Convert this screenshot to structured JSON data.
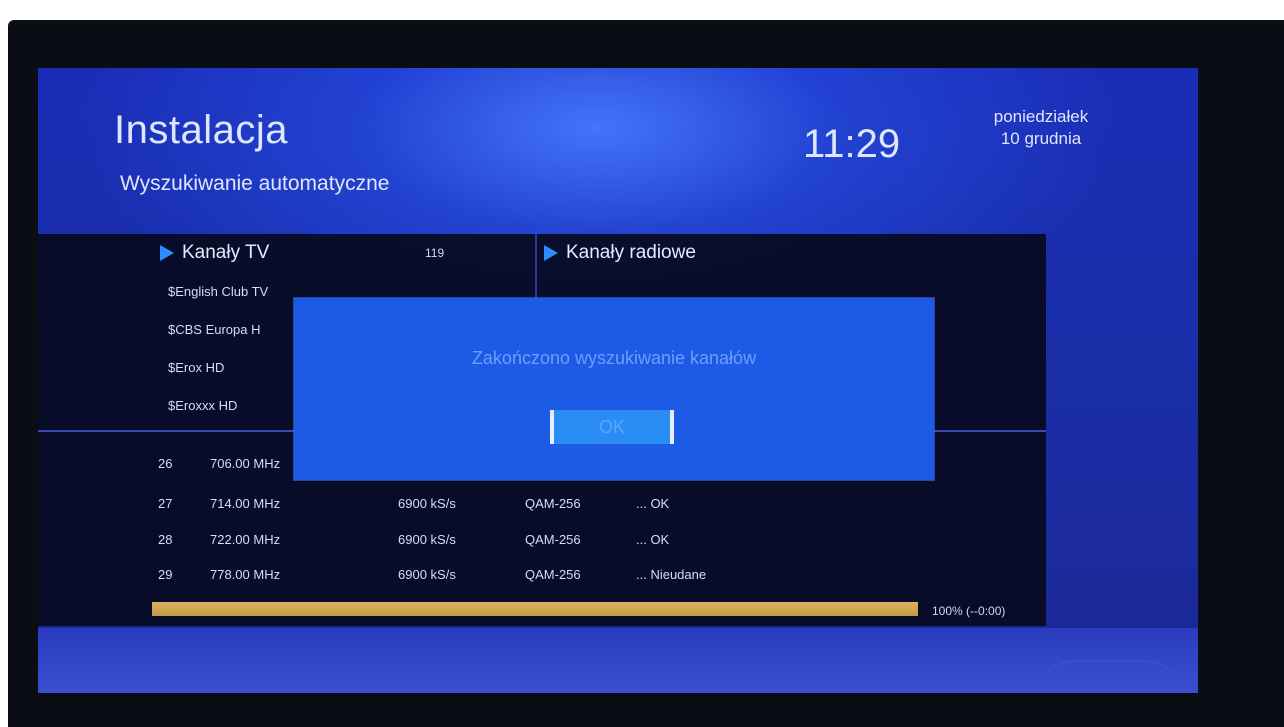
{
  "header": {
    "title": "Instalacja",
    "subtitle": "Wyszukiwanie automatyczne",
    "time": "11:29",
    "day": "poniedziałek",
    "date": "10 grudnia"
  },
  "tv_section": {
    "label": "Kanały TV",
    "count": "119",
    "channels": [
      "$English Club TV",
      "$CBS Europa H",
      "$Erox HD",
      "$Eroxxx HD"
    ]
  },
  "radio_section": {
    "label": "Kanały radiowe"
  },
  "scan_rows": [
    {
      "num": "26",
      "freq": "706.00 MHz",
      "rate": "",
      "mod": "",
      "status": ""
    },
    {
      "num": "27",
      "freq": "714.00 MHz",
      "rate": "6900 kS/s",
      "mod": "QAM-256",
      "status": "... OK"
    },
    {
      "num": "28",
      "freq": "722.00 MHz",
      "rate": "6900 kS/s",
      "mod": "QAM-256",
      "status": "... OK"
    },
    {
      "num": "29",
      "freq": "778.00 MHz",
      "rate": "6900 kS/s",
      "mod": "QAM-256",
      "status": "... Nieudane"
    }
  ],
  "progress": {
    "percent": 100,
    "label": "100% (--0:00)"
  },
  "dialog": {
    "message": "Zakończono wyszukiwanie kanałów",
    "ok_label": "OK"
  },
  "colors": {
    "screen_blue": "#1a2db8",
    "dialog_blue": "#1d5be6",
    "accent_arrow": "#2e8bff",
    "progress_gold": "#c49a44"
  },
  "icons": {
    "section_marker": "play-arrow-icon"
  }
}
